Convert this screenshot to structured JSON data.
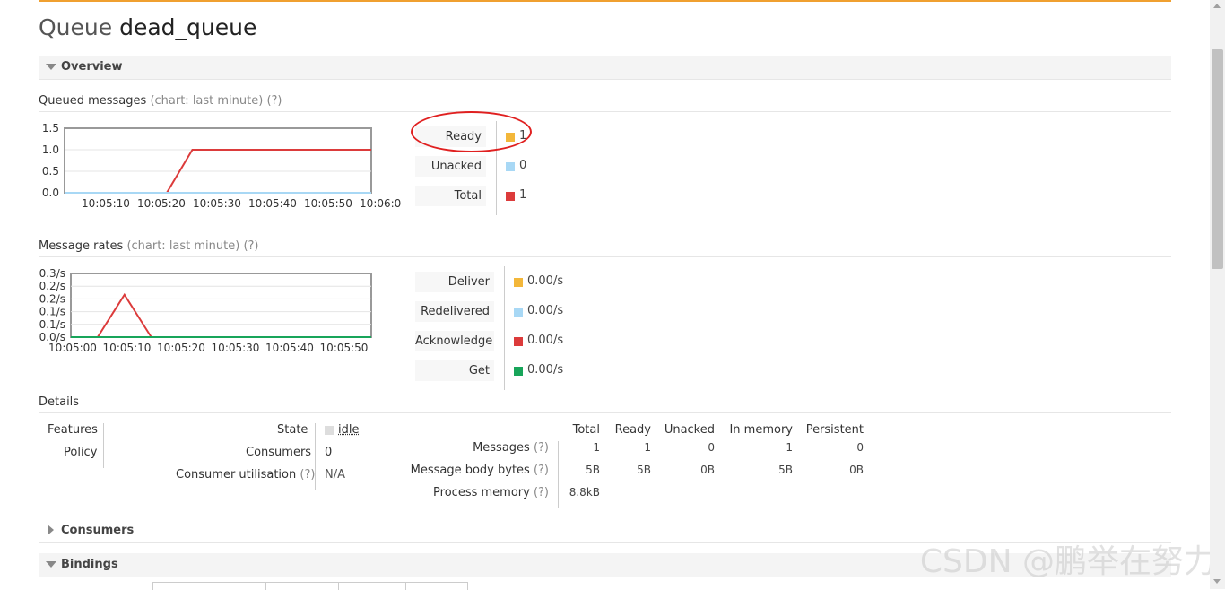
{
  "page": {
    "title_kind": "Queue",
    "title_name": "dead_queue",
    "watermark": "CSDN @鹏举在努力"
  },
  "sections": {
    "overview": "Overview",
    "consumers": "Consumers",
    "bindings": "Bindings"
  },
  "queued": {
    "heading": "Queued messages",
    "hint": "(chart: last minute) (?)",
    "legend": [
      {
        "label": "Ready",
        "value": "1",
        "color": "#f3b73a"
      },
      {
        "label": "Unacked",
        "value": "0",
        "color": "#a8d8f5"
      },
      {
        "label": "Total",
        "value": "1",
        "color": "#dc3b3b"
      }
    ]
  },
  "rates": {
    "heading": "Message rates",
    "hint": "(chart: last minute) (?)",
    "legend": [
      {
        "label": "Deliver",
        "value": "0.00/s",
        "color": "#f3b73a"
      },
      {
        "label": "Redelivered",
        "value": "0.00/s",
        "color": "#a8d8f5"
      },
      {
        "label": "Acknowledge",
        "value": "0.00/s",
        "color": "#dc3b3b"
      },
      {
        "label": "Get",
        "value": "0.00/s",
        "color": "#18a55a"
      }
    ]
  },
  "chart_data": [
    {
      "type": "line",
      "title": "Queued messages",
      "x": [
        "10:05:05",
        "10:05:25",
        "10:05:30",
        "10:06:00",
        "10:06:05"
      ],
      "xticks": [
        "10:05:10",
        "10:05:20",
        "10:05:30",
        "10:05:40",
        "10:05:50",
        "10:06:00"
      ],
      "yticks": [
        "1.5",
        "1.0",
        "0.5",
        "0.0"
      ],
      "ylim": [
        0,
        1.5
      ],
      "xlim_seconds": [
        5,
        65
      ],
      "series": [
        {
          "name": "Total",
          "color": "#dc3b3b",
          "points": [
            [
              5,
              0
            ],
            [
              25,
              0
            ],
            [
              30,
              1
            ],
            [
              65,
              1
            ]
          ]
        },
        {
          "name": "Unacked",
          "color": "#a8d8f5",
          "points": [
            [
              5,
              0
            ],
            [
              65,
              0
            ]
          ]
        }
      ]
    },
    {
      "type": "line",
      "title": "Message rates",
      "xticks": [
        "10:05:00",
        "10:05:10",
        "10:05:20",
        "10:05:30",
        "10:05:40",
        "10:05:50"
      ],
      "yticks": [
        "0.3/s",
        "0.2/s",
        "0.2/s",
        "0.1/s",
        "0.1/s",
        "0.0/s"
      ],
      "ylim": [
        0,
        0.3
      ],
      "xlim_seconds": [
        0,
        56
      ],
      "series": [
        {
          "name": "Acknowledge",
          "color": "#dc3b3b",
          "points": [
            [
              5,
              0
            ],
            [
              10,
              0.2
            ],
            [
              15,
              0
            ]
          ]
        },
        {
          "name": "Get",
          "color": "#18a55a",
          "points": [
            [
              0,
              0
            ],
            [
              56,
              0
            ]
          ]
        }
      ]
    }
  ],
  "details": {
    "heading": "Details",
    "left": [
      {
        "label": "Features"
      },
      {
        "label": "Policy"
      }
    ],
    "mid": {
      "state_label": "State",
      "state_value": "idle",
      "consumers_label": "Consumers",
      "consumers_value": "0",
      "util_label": "Consumer utilisation",
      "util_hint": "(?)",
      "util_value": "N/A"
    },
    "table": {
      "columns": [
        "Total",
        "Ready",
        "Unacked",
        "In memory",
        "Persistent"
      ],
      "rows": [
        {
          "label": "Messages",
          "hint": "(?)",
          "cells": [
            "1",
            "1",
            "0",
            "1",
            "0"
          ]
        },
        {
          "label": "Message body bytes",
          "hint": "(?)",
          "cells": [
            "5B",
            "5B",
            "0B",
            "5B",
            "0B"
          ]
        },
        {
          "label": "Process memory",
          "hint": "(?)",
          "cells": [
            "8.8kB",
            "",
            "",
            "",
            ""
          ]
        }
      ]
    }
  }
}
